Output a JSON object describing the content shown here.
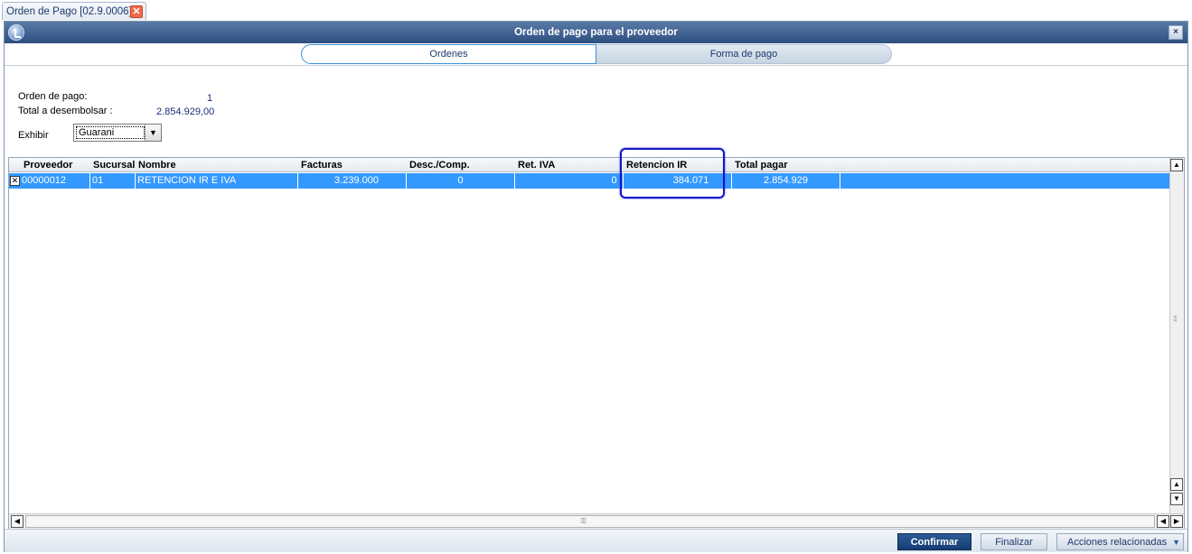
{
  "doc_tab": {
    "label": "Orden de Pago [02.9.0006]",
    "close": "✕"
  },
  "window": {
    "title": "Orden de pago para el proveedor",
    "close": "×"
  },
  "tabs": [
    {
      "label": "Ordenes"
    },
    {
      "label": "Forma de pago"
    }
  ],
  "summary": {
    "orden_label": "Orden de pago:",
    "orden_value": "1",
    "total_label": "Total a desembolsar :",
    "total_value": "2.854.929,00",
    "exhibir_label": "Exhibir",
    "exhibir_value": "Guarani"
  },
  "grid": {
    "columns": [
      "Proveedor",
      "Sucursal",
      "Nombre",
      "Facturas",
      "Desc./Comp.",
      "Ret. IVA",
      "Retencion IR",
      "Total pagar"
    ],
    "rows": [
      {
        "checked": true,
        "proveedor": "00000012",
        "sucursal": "01",
        "nombre": "RETENCION IR E IVA",
        "facturas": "3.239.000",
        "desc": "0",
        "ret_iva": "0",
        "ret_ir": "384.071",
        "total": "2.854.929"
      }
    ]
  },
  "footer": {
    "confirmar": "Confirmar",
    "finalizar": "Finalizar",
    "acciones": "Acciones relacionadas"
  },
  "colors": {
    "accent": "#2d4f80",
    "selection": "#3399ff",
    "highlight": "#1414c8"
  }
}
